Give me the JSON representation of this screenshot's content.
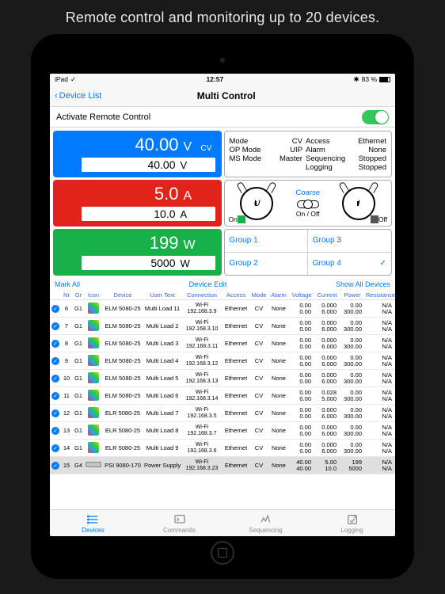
{
  "caption": "Remote control and monitoring up to 20 devices.",
  "status": {
    "carrier": "iPad",
    "time": "12:57",
    "bt": "83 %"
  },
  "nav": {
    "back": "Device List",
    "title": "Multi Control"
  },
  "remote": {
    "label": "Activate Remote Control"
  },
  "tiles": {
    "v": {
      "value": "40.00",
      "unit": "V",
      "tag": "CV",
      "set": "40.00"
    },
    "a": {
      "value": "5.0",
      "unit": "A",
      "set": "10.0"
    },
    "w": {
      "value": "199",
      "unit": "W",
      "set": "5000"
    }
  },
  "info": {
    "mode_k": "Mode",
    "mode_v": "CV",
    "op_k": "OP Mode",
    "op_v": "UIP",
    "ms_k": "MS Mode",
    "ms_v": "Master",
    "acc_k": "Access",
    "acc_v": "Ethernet",
    "alm_k": "Alarm",
    "alm_v": "None",
    "seq_k": "Sequencing",
    "seq_v": "Stopped",
    "log_k": "Logging",
    "log_v": "Stopped"
  },
  "knobs": {
    "left": "U",
    "right": "I",
    "mode": "Coarse",
    "onoff": "On / Off",
    "on": "On",
    "off": "Off"
  },
  "groups": {
    "g1": "Group 1",
    "g2": "Group 2",
    "g3": "Group 3",
    "g4": "Group 4"
  },
  "tbl": {
    "mark": "Mark All",
    "edit": "Device Edit",
    "show": "Show All Devices",
    "hdr": [
      "Nr",
      "Gr",
      "Icon",
      "Device",
      "User Text",
      "Connection",
      "Access",
      "Mode",
      "Alarm",
      "Voltage",
      "Current",
      "Power",
      "Resistance",
      ""
    ],
    "rows": [
      {
        "nr": "6",
        "gr": "G1",
        "dev": "ELM 5080-25",
        "ut": "Multi Load 11",
        "conn1": "Wi-Fi",
        "conn2": "192.168.3.9",
        "acc": "Ethernet",
        "mode": "CV",
        "alm": "None",
        "v1": "0.00",
        "v2": "0.00",
        "c1": "0.000",
        "c2": "6.000",
        "p1": "0.00",
        "p2": "300.00",
        "r": "N/A",
        "r2": "N/A"
      },
      {
        "nr": "7",
        "gr": "G1",
        "dev": "ELM 5080-25",
        "ut": "Multi Load 2",
        "conn1": "Wi-Fi",
        "conn2": "192.168.3.10",
        "acc": "Ethernet",
        "mode": "CV",
        "alm": "None",
        "v1": "0.00",
        "v2": "0.00",
        "c1": "0.000",
        "c2": "6.000",
        "p1": "0.00",
        "p2": "300.00",
        "r": "N/A",
        "r2": "N/A"
      },
      {
        "nr": "8",
        "gr": "G1",
        "dev": "ELM 5080-25",
        "ut": "Multi Load 3",
        "conn1": "Wi-Fi",
        "conn2": "192.168.3.11",
        "acc": "Ethernet",
        "mode": "CV",
        "alm": "None",
        "v1": "0.00",
        "v2": "0.00",
        "c1": "0.000",
        "c2": "6.000",
        "p1": "0.00",
        "p2": "300.00",
        "r": "N/A",
        "r2": "N/A"
      },
      {
        "nr": "9",
        "gr": "G1",
        "dev": "ELM 5080-25",
        "ut": "Multi Load 4",
        "conn1": "Wi-Fi",
        "conn2": "192.168.3.12",
        "acc": "Ethernet",
        "mode": "CV",
        "alm": "None",
        "v1": "0.00",
        "v2": "0.00",
        "c1": "0.000",
        "c2": "6.000",
        "p1": "0.00",
        "p2": "300.00",
        "r": "N/A",
        "r2": "N/A"
      },
      {
        "nr": "10",
        "gr": "G1",
        "dev": "ELM 5080-25",
        "ut": "Multi Load 5",
        "conn1": "Wi-Fi",
        "conn2": "192.168.3.13",
        "acc": "Ethernet",
        "mode": "CV",
        "alm": "None",
        "v1": "0.00",
        "v2": "0.00",
        "c1": "0.000",
        "c2": "6.000",
        "p1": "0.00",
        "p2": "300.00",
        "r": "N/A",
        "r2": "N/A"
      },
      {
        "nr": "11",
        "gr": "G1",
        "dev": "ELM 5080-25",
        "ut": "Multi Load 6",
        "conn1": "Wi-Fi",
        "conn2": "192.168.3.14",
        "acc": "Ethernet",
        "mode": "CV",
        "alm": "None",
        "v1": "0.00",
        "v2": "0.00",
        "c1": "0.028",
        "c2": "5.000",
        "p1": "0.00",
        "p2": "300.00",
        "r": "N/A",
        "r2": "N/A"
      },
      {
        "nr": "12",
        "gr": "G1",
        "dev": "ELR 5080-25",
        "ut": "Multi Load 7",
        "conn1": "Wi-Fi",
        "conn2": "192.168.3.5",
        "acc": "Ethernet",
        "mode": "CV",
        "alm": "None",
        "v1": "0.00",
        "v2": "0.00",
        "c1": "0.000",
        "c2": "6.000",
        "p1": "0.00",
        "p2": "300.00",
        "r": "N/A",
        "r2": "N/A"
      },
      {
        "nr": "13",
        "gr": "G1",
        "dev": "ELR 5080-25",
        "ut": "Multi Load 8",
        "conn1": "Wi-Fi",
        "conn2": "192.168.3.7",
        "acc": "Ethernet",
        "mode": "CV",
        "alm": "None",
        "v1": "0.00",
        "v2": "0.00",
        "c1": "0.000",
        "c2": "6.000",
        "p1": "0.00",
        "p2": "300.00",
        "r": "N/A",
        "r2": "N/A"
      },
      {
        "nr": "14",
        "gr": "G1",
        "dev": "ELR 5080-25",
        "ut": "Multi Load 9",
        "conn1": "Wi-Fi",
        "conn2": "192.168.3.6",
        "acc": "Ethernet",
        "mode": "CV",
        "alm": "None",
        "v1": "0.00",
        "v2": "0.00",
        "c1": "0.000",
        "c2": "6.000",
        "p1": "0.00",
        "p2": "300.00",
        "r": "N/A",
        "r2": "N/A"
      },
      {
        "nr": "15",
        "gr": "G4",
        "dev": "PSI 9080-170",
        "ut": "Power Supply",
        "conn1": "Wi-Fi",
        "conn2": "192.168.3.23",
        "acc": "Ethernet",
        "mode": "CV",
        "alm": "None",
        "v1": "40.00",
        "v2": "40.00",
        "c1": "5.00",
        "c2": "10.0",
        "p1": "199",
        "p2": "5000",
        "r": "N/A",
        "r2": "N/A",
        "sel": true,
        "ps": true
      }
    ]
  },
  "tabs": {
    "devices": "Devices",
    "commands": "Commands",
    "sequencing": "Sequencing",
    "logging": "Logging"
  }
}
